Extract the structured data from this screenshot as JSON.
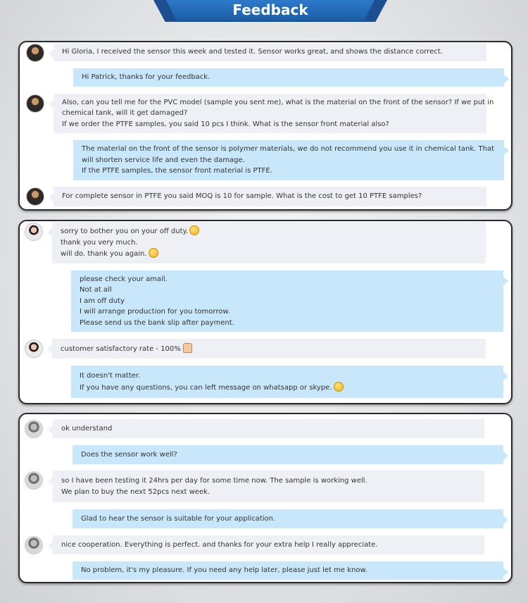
{
  "header": {
    "title": "Feedback"
  },
  "panels": [
    {
      "messages": [
        {
          "lines": [
            "Hi Gloria, I received the sensor this week and tested it. Sensor works great, and shows the distance correct."
          ]
        },
        {
          "lines": [
            "Hi Patrick, thanks for your feedback."
          ]
        },
        {
          "lines": [
            "Also, can you tell me for the PVC model (sample you sent me), what is the material on the front of the sensor?  If we put in",
            "chemical tank, will it get damaged?",
            "If we order the PTFE samples,  you said 10 pcs I think. What is the sensor front material also?"
          ]
        },
        {
          "lines": [
            "The material on the front of the sensor is polymer materials, we do not recommend you use it in chemical tank. That will shorten service life and even the damage.",
            "If the PTFE samples, the sensor front material is PTFE."
          ]
        },
        {
          "lines": [
            "For complete sensor in PTFE you said MOQ is 10 for sample.  What is the cost to get 10 PTFE samples?"
          ]
        }
      ]
    },
    {
      "messages": [
        {
          "lines": [
            "sorry to bother you on your off duty.",
            "thank you very much.",
            "will do. thank you again."
          ]
        },
        {
          "lines": [
            "please check your amail.",
            "Not at all",
            "I am off duty",
            "I will arrange production for you tomorrow.",
            "Please send us the bank slip after payment."
          ]
        },
        {
          "lines": [
            "customer satisfactory rate - 100%"
          ]
        },
        {
          "lines": [
            "It doesn't matter.",
            "If you have any questions, you can left message on whatsapp or skype."
          ]
        }
      ]
    },
    {
      "messages": [
        {
          "lines": [
            "ok understand"
          ]
        },
        {
          "lines": [
            "Does the sensor work well?"
          ]
        },
        {
          "lines": [
            "so I have been testing it 24hrs per day for some time now. The sample is working well.",
            "We plan to buy the next 52pcs next week."
          ]
        },
        {
          "lines": [
            "Glad to hear the sensor is suitable for your application."
          ]
        },
        {
          "lines": [
            "nice cooperation. Everything is perfect. and thanks for your extra help I really appreciate."
          ]
        },
        {
          "lines": [
            "No problem, it's my pleasure. If you need any help later, please just let me know."
          ]
        }
      ]
    }
  ],
  "icons": {
    "sad": "sad-face-icon",
    "smile": "smile-face-icon",
    "thumbs_up": "thumbs-up-icon",
    "grin": "grin-face-icon"
  }
}
